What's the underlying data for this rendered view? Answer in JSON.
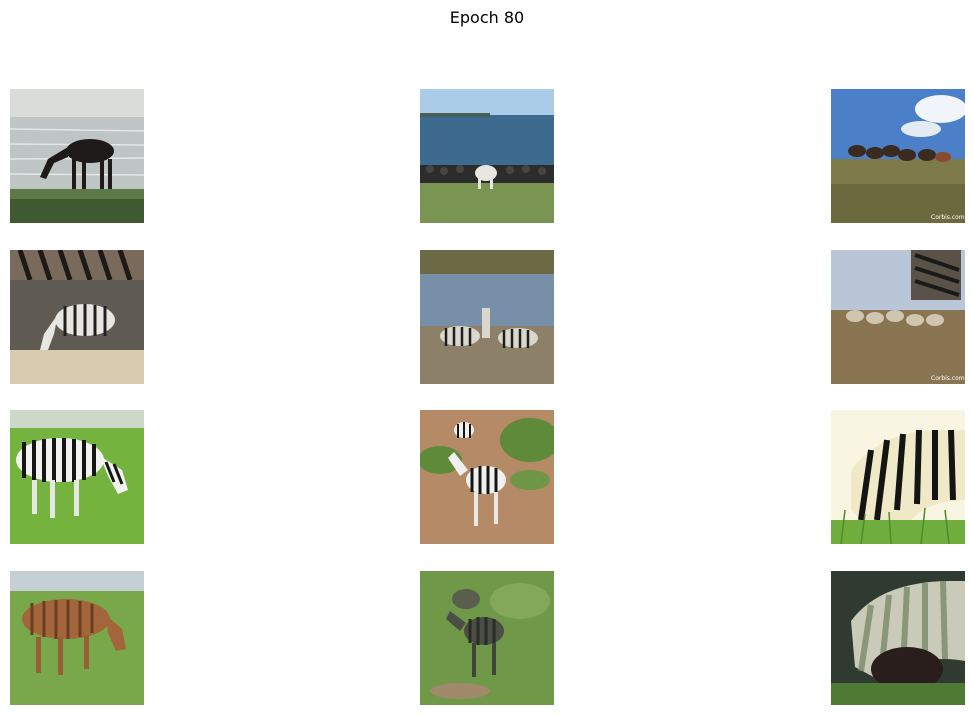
{
  "figure": {
    "title": "Epoch 80"
  },
  "grid": {
    "rows": 4,
    "columns": 3,
    "tiles": [
      {
        "row": 0,
        "col": 0,
        "subject": "dark horse grazing by the sea"
      },
      {
        "row": 0,
        "col": 1,
        "subject": "white horse by stone wall near sea"
      },
      {
        "row": 0,
        "col": 2,
        "subject": "herd of horses running on hill",
        "watermark": "Corbis.com"
      },
      {
        "row": 1,
        "col": 0,
        "subject": "generated zebra grazing"
      },
      {
        "row": 1,
        "col": 1,
        "subject": "generated zebras by water"
      },
      {
        "row": 1,
        "col": 2,
        "subject": "generated striped herd on hill",
        "watermark": "Corbis.com"
      },
      {
        "row": 2,
        "col": 0,
        "subject": "zebra grazing on grass"
      },
      {
        "row": 2,
        "col": 1,
        "subject": "two zebras standing on dirt"
      },
      {
        "row": 2,
        "col": 2,
        "subject": "zebra head close-up in grass"
      },
      {
        "row": 3,
        "col": 0,
        "subject": "generated brown horse grazing"
      },
      {
        "row": 3,
        "col": 1,
        "subject": "generated dark horses on grass"
      },
      {
        "row": 3,
        "col": 2,
        "subject": "generated horse head close-up"
      }
    ]
  }
}
